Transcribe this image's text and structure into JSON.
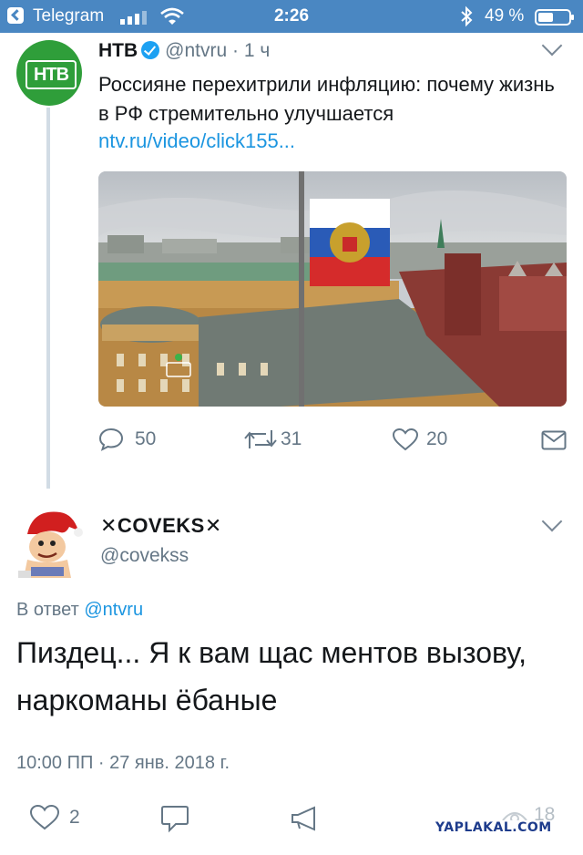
{
  "status_bar": {
    "app": "Telegram",
    "time": "2:26",
    "battery": "49 %"
  },
  "tweet1": {
    "avatar_logo": "НТВ",
    "name": "НТВ",
    "handle": "@ntvru",
    "separator": "·",
    "time": "1 ч",
    "text": "Россияне перехитрили инфляцию: почему жизнь в РФ стремительно улучшается",
    "link": "ntv.ru/video/click155...",
    "media_logo": "НТВ",
    "replies": "50",
    "retweets": "31",
    "likes": "20"
  },
  "tweet2": {
    "name": "✕COVEKS✕",
    "handle": "@covekss",
    "reply_prefix": "В ответ",
    "reply_mention": "@ntvru",
    "text": "Пиздец... Я к вам щас ментов вызову, наркоманы ёбаные",
    "date": "10:00 ПП · 27 янв. 2018 г.",
    "likes": "2",
    "views": "18"
  },
  "watermark": "YAPLAKAL.COM",
  "colors": {
    "status_bar": "#4a87c2",
    "link": "#1b95e0",
    "secondary_text": "#657786",
    "ntv_green": "#2f9e3a"
  }
}
